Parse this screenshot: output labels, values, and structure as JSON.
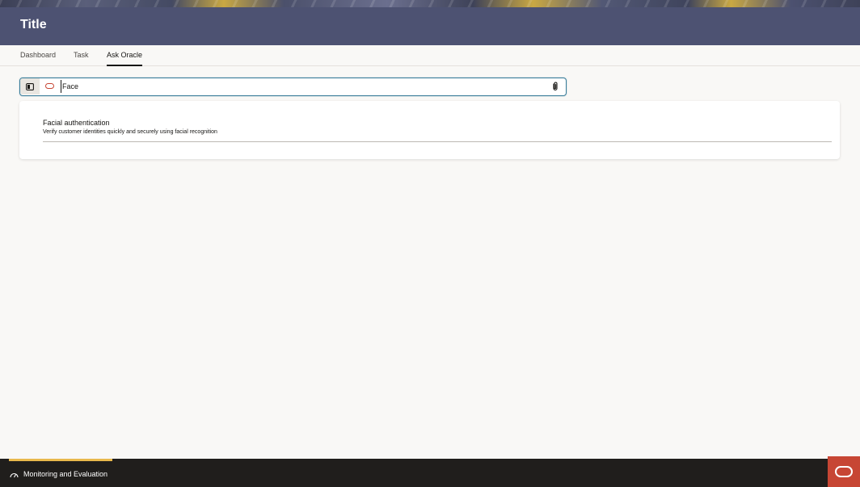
{
  "header": {
    "title": "Title"
  },
  "tabs": [
    {
      "label": "Dashboard",
      "active": false
    },
    {
      "label": "Task",
      "active": false
    },
    {
      "label": "Ask Oracle",
      "active": true
    }
  ],
  "search": {
    "value": "Face",
    "placeholder": ""
  },
  "results": [
    {
      "title": "Facial authentication",
      "description": "Verify customer identities quickly and securely using facial recognition"
    }
  ],
  "footer": {
    "label": "Monitoring and Evaluation"
  },
  "colors": {
    "header_bg": "#4d5272",
    "accent_red": "#c74634",
    "footer_bg": "#201e1c",
    "footer_accent": "#e9b94c",
    "focus_border": "#3a7d9a"
  },
  "icons": {
    "side_toggle": "sidebar-toggle-icon",
    "oracle": "oracle-logo-icon",
    "attach": "paperclip-icon",
    "footer": "gauge-icon"
  }
}
